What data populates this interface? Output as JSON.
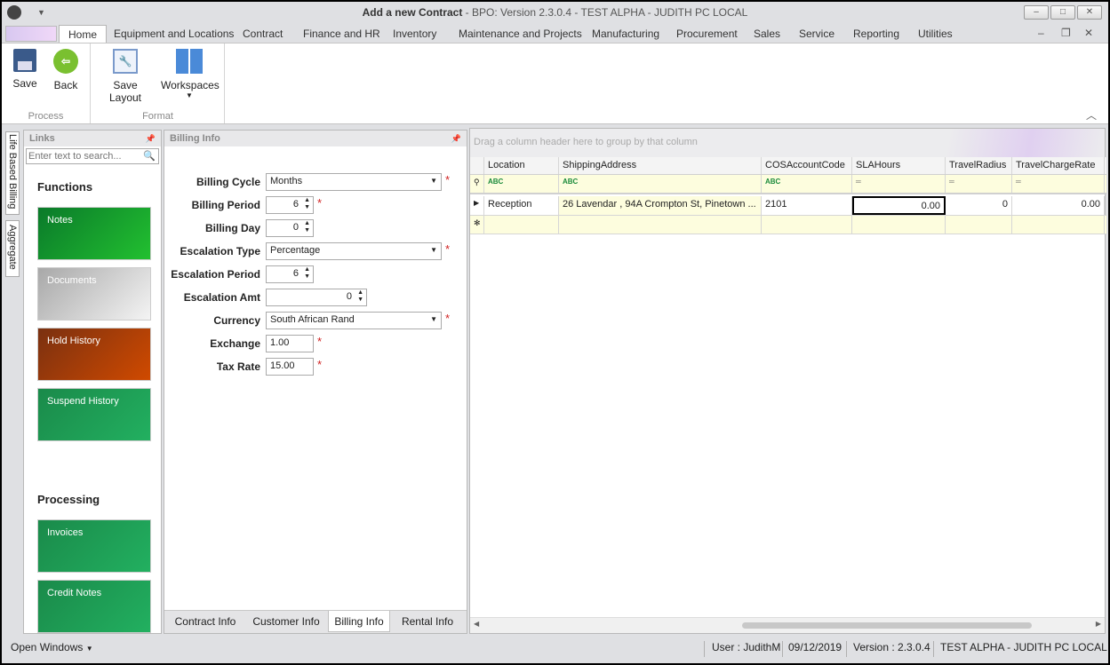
{
  "window": {
    "title_main": "Add a new Contract",
    "title_rest": " - BPO: Version 2.3.0.4 - TEST ALPHA - JUDITH PC LOCAL"
  },
  "menu_tabs": [
    "Home",
    "Equipment and Locations",
    "Contract",
    "Finance and HR",
    "Inventory",
    "Maintenance and Projects",
    "Manufacturing",
    "Procurement",
    "Sales",
    "Service",
    "Reporting",
    "Utilities"
  ],
  "ribbon": {
    "save": "Save",
    "back": "Back",
    "save_layout": "Save Layout",
    "workspaces": "Workspaces",
    "group_process": "Process",
    "group_format": "Format"
  },
  "side_tabs": [
    "Life Based Billing",
    "Aggregate"
  ],
  "links": {
    "title": "Links",
    "search_placeholder": "Enter text to search...",
    "functions_heading": "Functions",
    "functions": [
      {
        "label": "Notes",
        "color": "#1aa83a"
      },
      {
        "label": "Documents",
        "color": "#b8b8b8"
      },
      {
        "label": "Hold History",
        "color": "#b5440f"
      },
      {
        "label": "Suspend History",
        "color": "#1fa855"
      }
    ],
    "processing_heading": "Processing",
    "processing": [
      {
        "label": "Invoices",
        "color": "#1fa855"
      },
      {
        "label": "Credit Notes",
        "color": "#1fa855"
      }
    ]
  },
  "billing": {
    "title": "Billing Info",
    "fields": [
      {
        "label": "Billing Cycle",
        "value": "Months",
        "type": "dropdown",
        "required": true
      },
      {
        "label": "Billing Period",
        "value": "6",
        "type": "spin",
        "required": true
      },
      {
        "label": "Billing Day",
        "value": "0",
        "type": "spin",
        "required": false
      },
      {
        "label": "Escalation Type",
        "value": "Percentage",
        "type": "dropdown",
        "required": true
      },
      {
        "label": "Escalation Period",
        "value": "6",
        "type": "spin",
        "required": false
      },
      {
        "label": "Escalation Amt",
        "value": "0",
        "type": "spinwide",
        "required": false
      },
      {
        "label": "Currency",
        "value": "South African Rand",
        "type": "dropdown",
        "required": true
      },
      {
        "label": "Exchange",
        "value": "1.00",
        "type": "text",
        "required": true
      },
      {
        "label": "Tax Rate",
        "value": "15.00",
        "type": "text",
        "required": true
      }
    ],
    "tabs": [
      "Contract Info",
      "Customer Info",
      "Billing Info",
      "Rental Info"
    ],
    "active_tab": "Billing Info"
  },
  "grid": {
    "group_hint": "Drag a column header here to group by that column",
    "columns": [
      "Location",
      "ShippingAddress",
      "COSAccountCode",
      "SLAHours",
      "TravelRadius",
      "TravelChargeRate"
    ],
    "rows": [
      [
        "Reception",
        "26 Lavendar , 94A Crompton St, Pinetown ...",
        "2101",
        "0.00",
        "0",
        "0.00"
      ]
    ]
  },
  "status": {
    "open_windows": "Open Windows",
    "user": "User : JudithM",
    "date": "09/12/2019",
    "version": "Version : 2.3.0.4",
    "env": "TEST ALPHA - JUDITH PC LOCAL"
  }
}
